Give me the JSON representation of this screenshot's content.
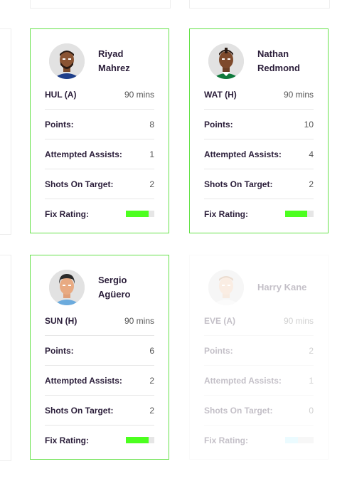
{
  "colors": {
    "highlight_border": "#66e24a",
    "rating_green": "#4cff1f",
    "rating_cyan": "#b8f4ff"
  },
  "cards": [
    {
      "name_line1": "Riyad",
      "name_line2": "Mahrez",
      "fixture": "HUL (A)",
      "minutes": "90 mins",
      "points_label": "Points:",
      "points": "8",
      "assists_label": "Attempted Assists:",
      "assists": "1",
      "shots_label": "Shots On Target:",
      "shots": "2",
      "rating_label": "Fix Rating:",
      "rating_fraction": 0.8,
      "avatar": "player-avatar-dark-skin-beard-blue-kit"
    },
    {
      "name_line1": "Nathan",
      "name_line2": "Redmond",
      "fixture": "WAT (H)",
      "minutes": "90 mins",
      "points_label": "Points:",
      "points": "10",
      "assists_label": "Attempted Assists:",
      "assists": "4",
      "shots_label": "Shots On Target:",
      "shots": "2",
      "rating_label": "Fix Rating:",
      "rating_fraction": 0.78,
      "avatar": "player-avatar-dark-skin-green-kit"
    },
    {
      "name_line1": "Sergio",
      "name_line2": "Agüero",
      "fixture": "SUN (H)",
      "minutes": "90 mins",
      "points_label": "Points:",
      "points": "6",
      "assists_label": "Attempted Assists:",
      "assists": "2",
      "shots_label": "Shots On Target:",
      "shots": "2",
      "rating_label": "Fix Rating:",
      "rating_fraction": 0.8,
      "avatar": "player-avatar-light-skin-sky-blue-kit"
    },
    {
      "name_line1": "Harry Kane",
      "name_line2": "",
      "fixture": "EVE (A)",
      "minutes": "90 mins",
      "points_label": "Points:",
      "points": "2",
      "assists_label": "Attempted Assists:",
      "assists": "1",
      "shots_label": "Shots On Target:",
      "shots": "0",
      "rating_label": "Fix Rating:",
      "rating_fraction": 0.45,
      "avatar": "player-avatar-light-skin-white-kit"
    }
  ]
}
